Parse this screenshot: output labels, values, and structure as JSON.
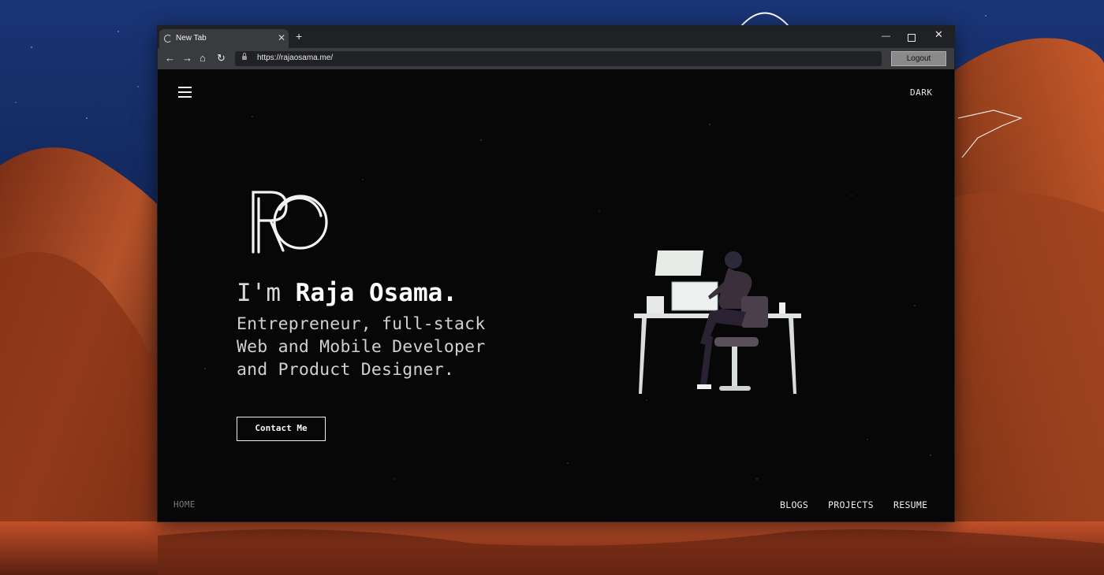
{
  "browser": {
    "tab_title": "New Tab",
    "tab_close": "✕",
    "new_tab": "+",
    "window_controls": {
      "minimize": "—",
      "close": "✕"
    },
    "nav": {
      "back": "←",
      "forward": "→",
      "home": "⌂",
      "reload": "↻"
    },
    "url": "https://rajaosama.me/",
    "logout_label": "Logout"
  },
  "page": {
    "theme_toggle": "DARK",
    "logo_text": "RO",
    "headline_prefix": "I'm ",
    "headline_name": "Raja Osama.",
    "tagline_lines": [
      "Entrepreneur, full-stack",
      "Web and Mobile Developer",
      "and Product Designer."
    ],
    "contact_label": "Contact Me",
    "footer_nav": {
      "home": "HOME",
      "blogs": "BLOGS",
      "projects": "PROJECTS",
      "resume": "RESUME"
    }
  },
  "colors": {
    "page_background": "#070707",
    "text_primary": "#f0f0f0",
    "nav_inactive": "#7a7a7a",
    "browser_chrome": "#3a3b3e",
    "wallpaper_sky": "#0e1f4a",
    "wallpaper_rock": "#b5522a"
  }
}
